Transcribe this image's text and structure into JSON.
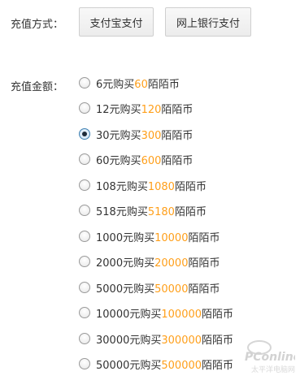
{
  "payment_method": {
    "label": "充值方式：",
    "buttons": [
      "支付宝支付",
      "网上银行支付"
    ]
  },
  "amount": {
    "label": "充值金额：",
    "selected_index": 2,
    "options": [
      {
        "price": "6",
        "currency_unit": "元购买",
        "coins": "60",
        "coin_name": "陌陌币"
      },
      {
        "price": "12",
        "currency_unit": "元购买",
        "coins": "120",
        "coin_name": "陌陌币"
      },
      {
        "price": "30",
        "currency_unit": "元购买",
        "coins": "300",
        "coin_name": "陌陌币"
      },
      {
        "price": "60",
        "currency_unit": "元购买",
        "coins": "600",
        "coin_name": "陌陌币"
      },
      {
        "price": "108",
        "currency_unit": "元购买",
        "coins": "1080",
        "coin_name": "陌陌币"
      },
      {
        "price": "518",
        "currency_unit": "元购买",
        "coins": "5180",
        "coin_name": "陌陌币"
      },
      {
        "price": "1000",
        "currency_unit": "元购买",
        "coins": "10000",
        "coin_name": "陌陌币"
      },
      {
        "price": "2000",
        "currency_unit": "元购买",
        "coins": "20000",
        "coin_name": "陌陌币"
      },
      {
        "price": "5000",
        "currency_unit": "元购买",
        "coins": "50000",
        "coin_name": "陌陌币"
      },
      {
        "price": "10000",
        "currency_unit": "元购买",
        "coins": "100000",
        "coin_name": "陌陌币"
      },
      {
        "price": "30000",
        "currency_unit": "元购买",
        "coins": "300000",
        "coin_name": "陌陌币"
      },
      {
        "price": "50000",
        "currency_unit": "元购买",
        "coins": "500000",
        "coin_name": "陌陌币"
      }
    ]
  },
  "watermark": {
    "text": "PConline",
    "subtext": "太平洋电脑网"
  },
  "colors": {
    "coin_amount": "#ff9f1a",
    "text": "#333333",
    "radio_checked": "#3c7fb1"
  }
}
